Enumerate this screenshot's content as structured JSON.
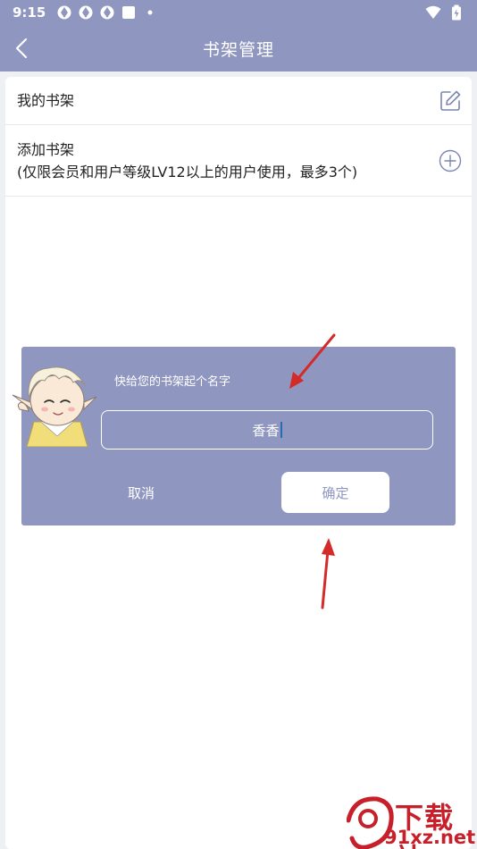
{
  "status_bar": {
    "time": "9:15"
  },
  "app_bar": {
    "title": "书架管理"
  },
  "list": {
    "my_shelf_label": "我的书架",
    "add_shelf_label": "添加书架",
    "add_shelf_note": "(仅限会员和用户等级LV12以上的用户使用，最多3个)"
  },
  "dialog": {
    "title": "快给您的书架起个名字",
    "input_value": "香香",
    "cancel_label": "取消",
    "confirm_label": "确定"
  },
  "watermark": {
    "brand_top": "下载站",
    "brand_bottom": "91xz.net"
  },
  "colors": {
    "header": "#8f96c0",
    "dialog": "#8f96c0",
    "arrow": "#d42a2a",
    "watermark": "#c8202a"
  }
}
